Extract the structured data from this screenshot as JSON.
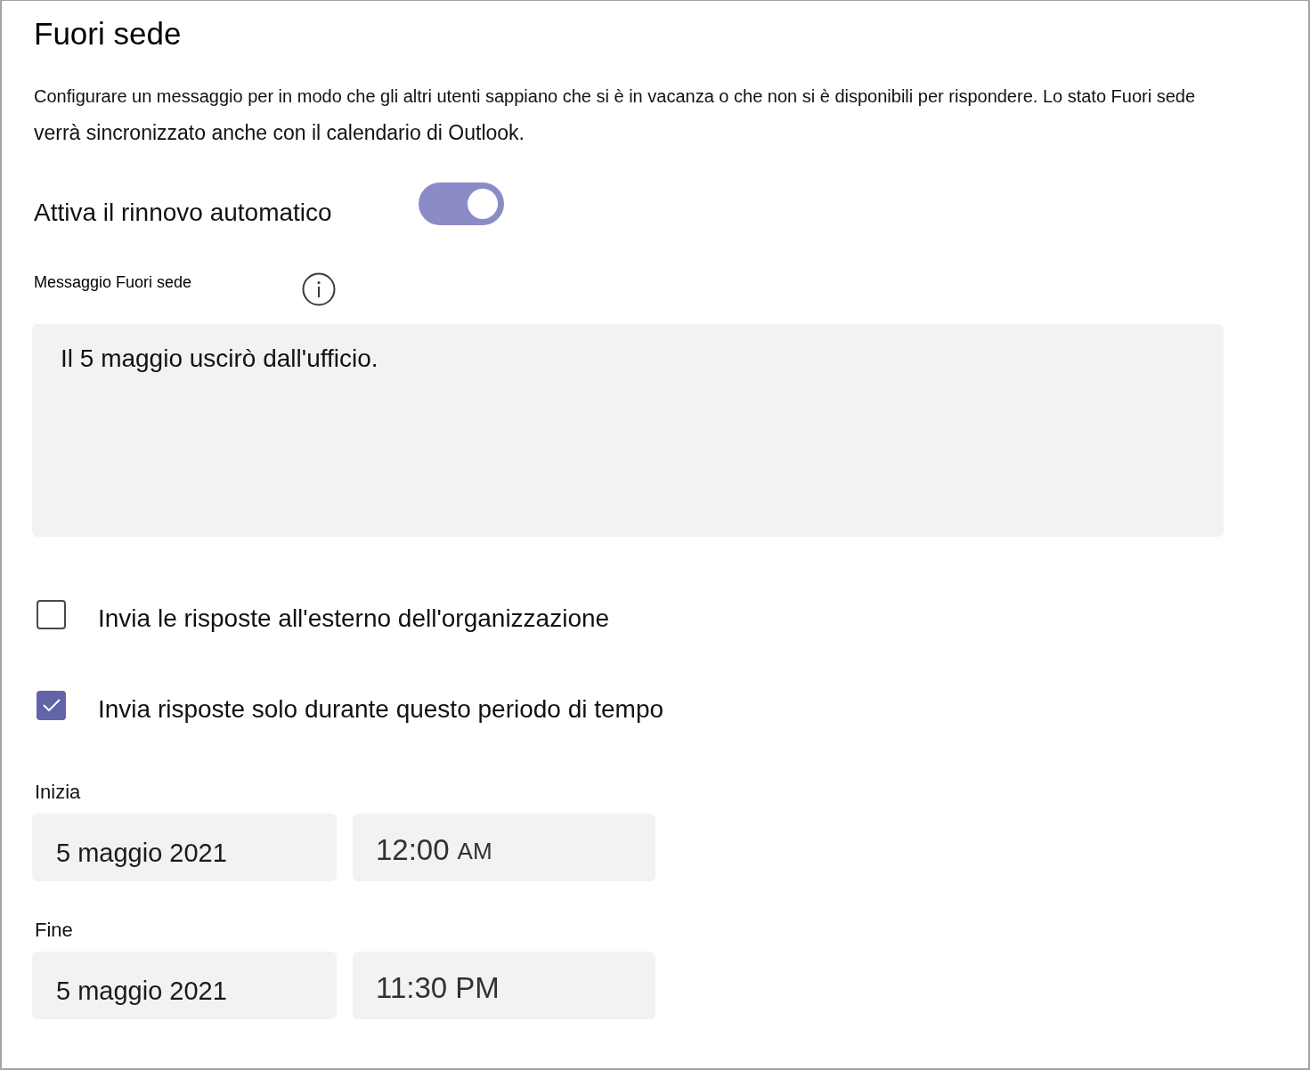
{
  "page": {
    "title": "Fuori sede",
    "description": [
      "Configurare un messaggio per in modo che gli altri utenti sappiano che si è in vacanza o che non si è disponibili per rispondere. Lo stato Fuori sede",
      "verrà sincronizzato anche con il calendario di Outlook."
    ]
  },
  "auto_renew": {
    "label": "Attiva il rinnovo automatico",
    "on": true
  },
  "message": {
    "label": "Messaggio Fuori sede",
    "value": "Il 5 maggio uscirò dall'ufficio."
  },
  "options": [
    {
      "label": "Invia le risposte all'esterno dell'organizzazione",
      "checked": false
    },
    {
      "label": "Invia risposte solo durante questo periodo di tempo",
      "checked": true
    }
  ],
  "schedule": [
    {
      "label": "Inizia",
      "date": "5 maggio 2021",
      "time": "12:00",
      "period": "AM"
    },
    {
      "label": "Fine",
      "date": "5 maggio 2021",
      "time": "11:30 PM"
    }
  ]
}
